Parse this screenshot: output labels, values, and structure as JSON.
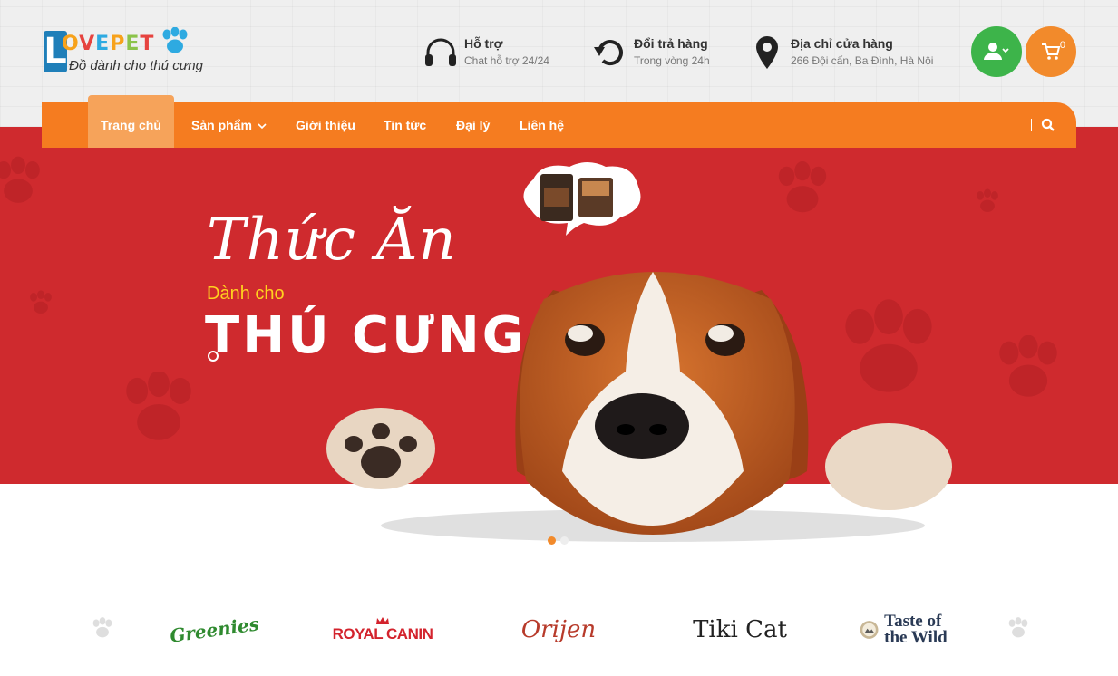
{
  "brand": {
    "logo_text": "LOVEPET",
    "tagline": "Đồ dành cho thú cưng"
  },
  "header_info": [
    {
      "icon": "headphones-icon",
      "title": "Hỗ trợ",
      "subtitle": "Chat hỗ trợ 24/24"
    },
    {
      "icon": "return-arrow-icon",
      "title": "Đổi trả hàng",
      "subtitle": "Trong vòng 24h"
    },
    {
      "icon": "location-pin-icon",
      "title": "Địa chỉ cửa hàng",
      "subtitle": "266 Đội cấn, Ba Đình, Hà Nội"
    }
  ],
  "account": {
    "icon": "user-icon"
  },
  "cart": {
    "icon": "cart-icon",
    "count": "0"
  },
  "nav": {
    "items": [
      {
        "label": "Trang chủ",
        "active": true
      },
      {
        "label": "Sản phẩm",
        "has_dropdown": true
      },
      {
        "label": "Giới thiệu"
      },
      {
        "label": "Tin tức"
      },
      {
        "label": "Đại lý"
      },
      {
        "label": "Liên hệ"
      }
    ],
    "search_icon": "search-icon"
  },
  "hero": {
    "script_title": "Thức Ăn",
    "subtitle": "Dành cho",
    "main_title": "THÚ CƯNG"
  },
  "slider": {
    "slide_count": 2,
    "active_index": 0
  },
  "brands": {
    "prev_icon": "paw-prev-icon",
    "next_icon": "paw-next-icon",
    "items": [
      {
        "name": "Greenies"
      },
      {
        "name": "ROYAL CANIN"
      },
      {
        "name": "Orijen"
      },
      {
        "name": "Tiki Cat"
      },
      {
        "name": "Taste of the Wild"
      }
    ]
  },
  "colors": {
    "nav_orange": "#f57c20",
    "active_tab": "#f6a35a",
    "banner_red": "#cf2a2e",
    "user_green": "#3db44a",
    "cart_orange": "#f28a2b",
    "hero_yellow": "#ffd21f"
  }
}
